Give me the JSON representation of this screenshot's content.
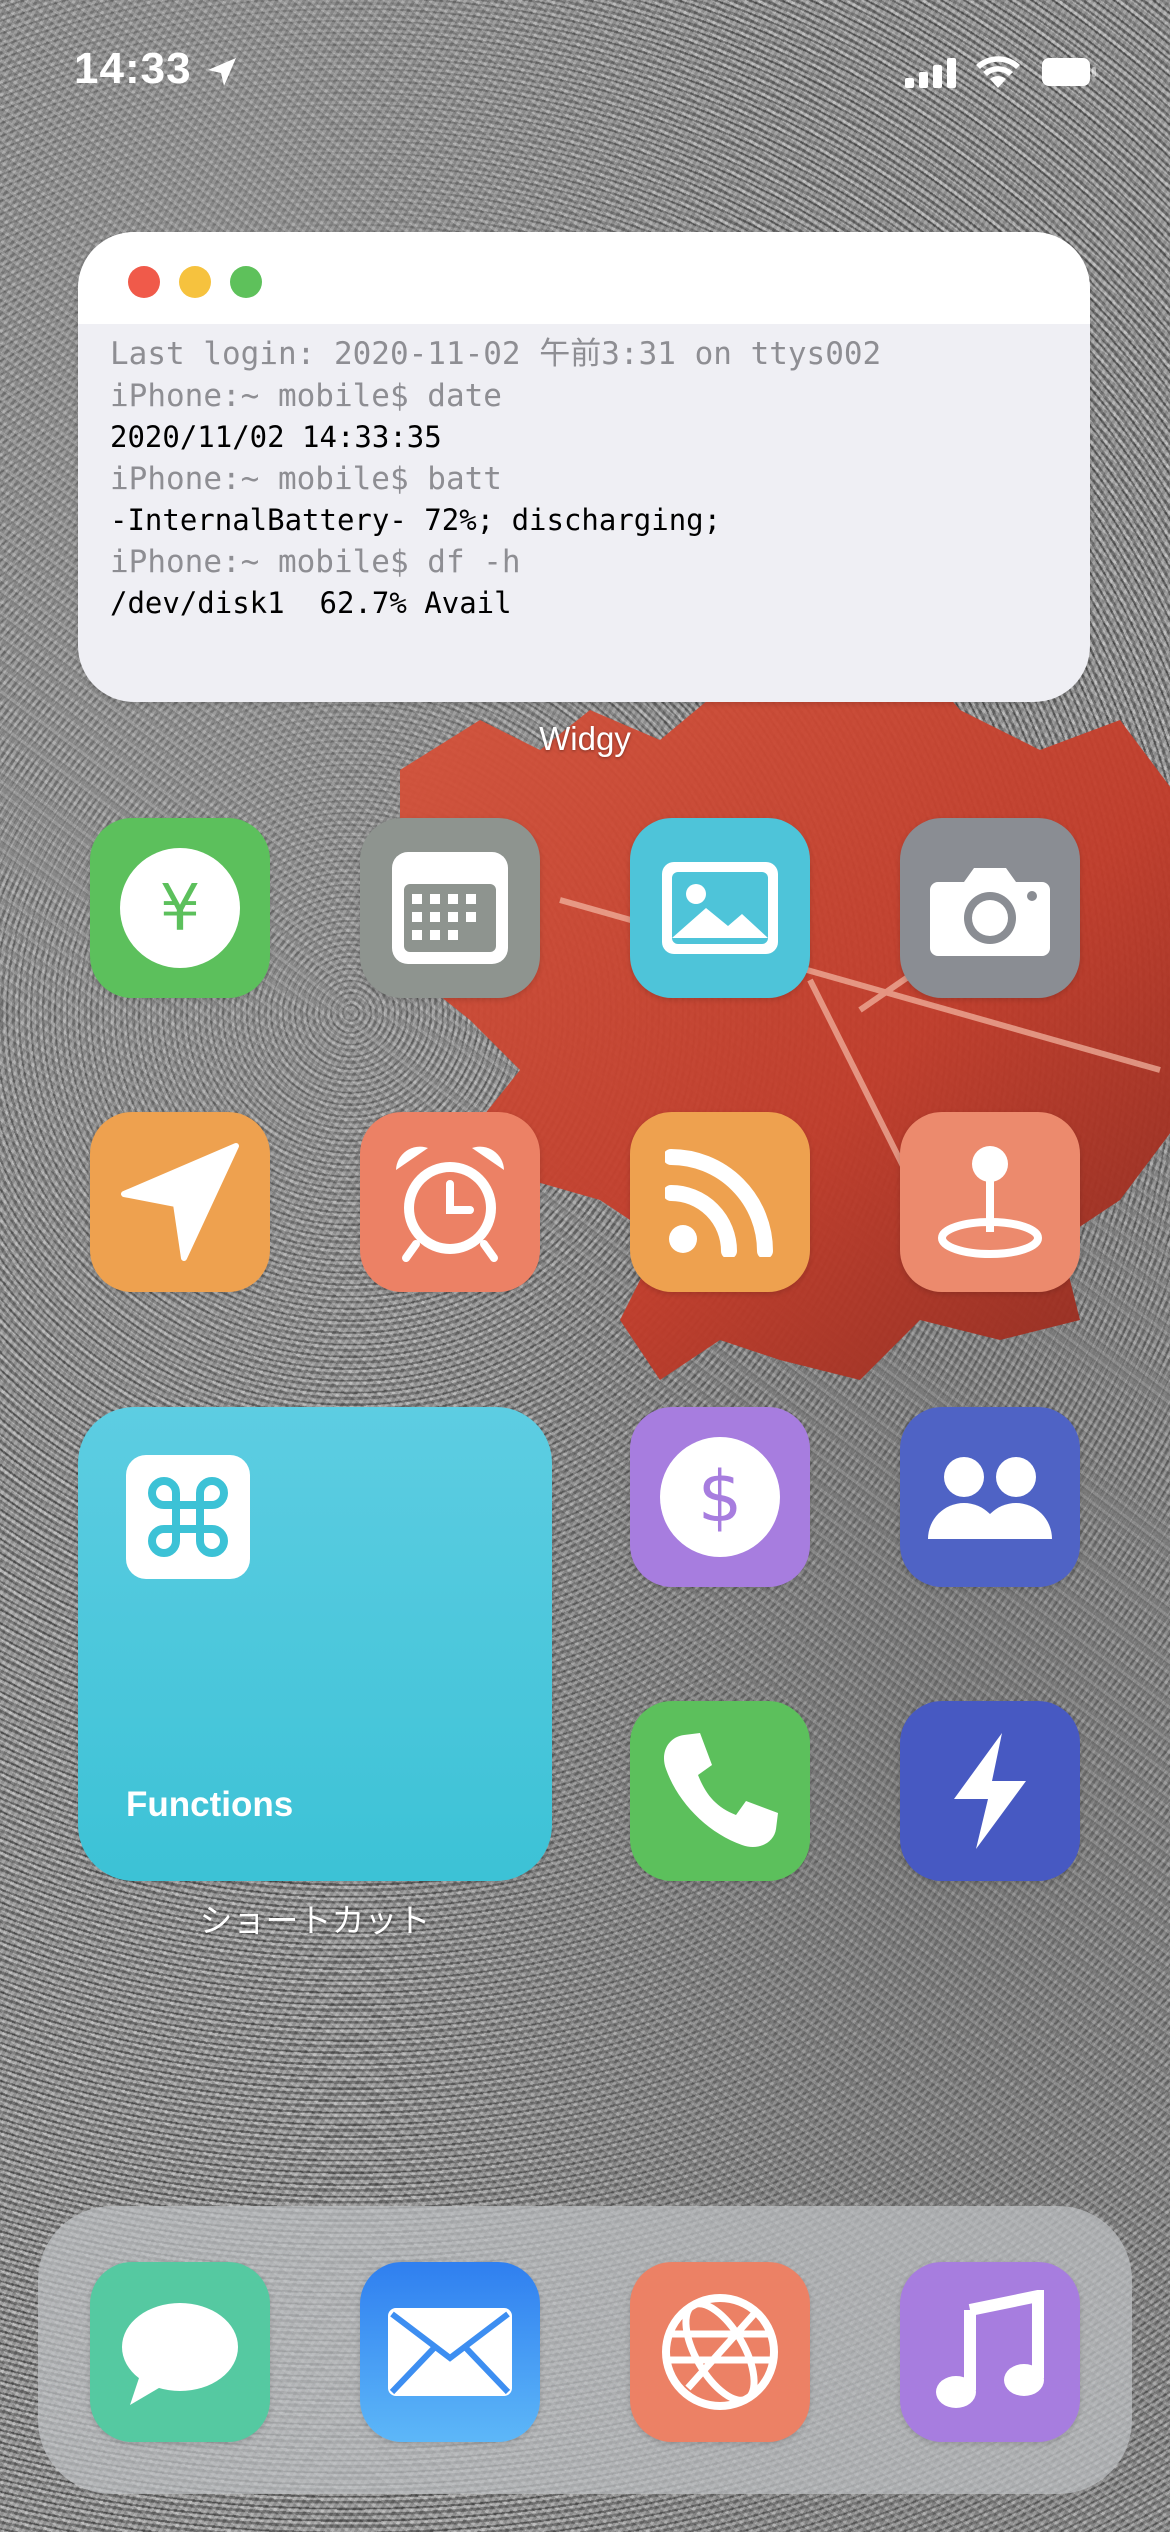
{
  "status_bar": {
    "time": "14:33"
  },
  "widgy": {
    "label": "Widgy",
    "lines": [
      "Last login: 2020-11-02 午前3:31 on ttys002",
      "iPhone:~ mobile$ date",
      "2020/11/02 14:33:35",
      "iPhone:~ mobile$ batt",
      "-InternalBattery- 72%; discharging;",
      "iPhone:~ mobile$ df -h",
      "/dev/disk1  62.7% Avail"
    ]
  },
  "shortcuts_widget": {
    "title": "Functions",
    "label": "ショートカット"
  },
  "apps": [
    {
      "name": "yen-icon",
      "color": "#5cc05c"
    },
    {
      "name": "calendar-icon",
      "color": "#8e948f"
    },
    {
      "name": "photo-icon",
      "color": "#4ec4d9"
    },
    {
      "name": "camera-icon",
      "color": "#8a8d93"
    },
    {
      "name": "location-arrow-icon",
      "color": "#eea14f"
    },
    {
      "name": "alarm-clock-icon",
      "color": "#ec8165"
    },
    {
      "name": "rss-icon",
      "color": "#eea14f"
    },
    {
      "name": "map-pin-icon",
      "color": "#ec8a6d"
    },
    {
      "name": "dollar-icon",
      "color": "#a77ddf"
    },
    {
      "name": "people-icon",
      "color": "#4f63c5"
    },
    {
      "name": "phone-icon",
      "color": "#5cc05c"
    },
    {
      "name": "bolt-icon",
      "color": "#4759c2"
    }
  ],
  "dock": [
    {
      "name": "messages-icon",
      "color": "#55c9a1"
    },
    {
      "name": "mail-icon",
      "color": "#3d8ef1"
    },
    {
      "name": "browser-globe-icon",
      "color": "#ec8165"
    },
    {
      "name": "music-icon",
      "color": "#a77ddf"
    }
  ]
}
